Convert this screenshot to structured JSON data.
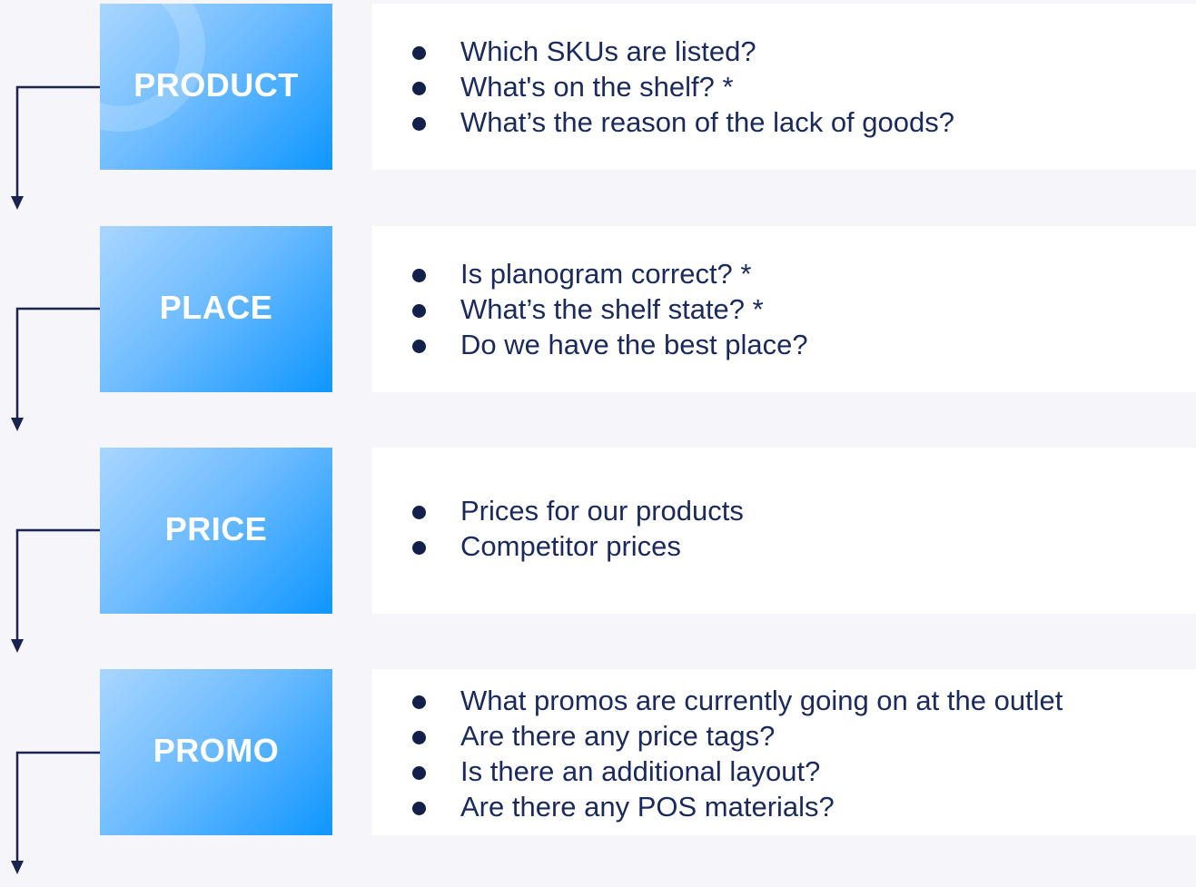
{
  "sections": [
    {
      "label": "PRODUCT",
      "items": [
        "Which SKUs are listed?",
        "What's on the shelf? *",
        "What’s the reason of the lack of goods?"
      ]
    },
    {
      "label": "PLACE",
      "items": [
        "Is planogram correct? *",
        "What’s the shelf state? *",
        "Do we have the best place?"
      ]
    },
    {
      "label": "PRICE",
      "items": [
        "Prices for our products",
        "Competitor prices"
      ]
    },
    {
      "label": "PROMO",
      "items": [
        "What promos are currently going on at the outlet",
        "Are there any price tags?",
        "Is there an additional layout?",
        "Are there any POS materials?"
      ]
    }
  ],
  "colors": {
    "label_gradient_start": "#a9d6ff",
    "label_gradient_end": "#0e96ff",
    "text": "#1a2a5e",
    "connector": "#1a2450",
    "background": "#f5f5fa",
    "card": "#ffffff"
  }
}
